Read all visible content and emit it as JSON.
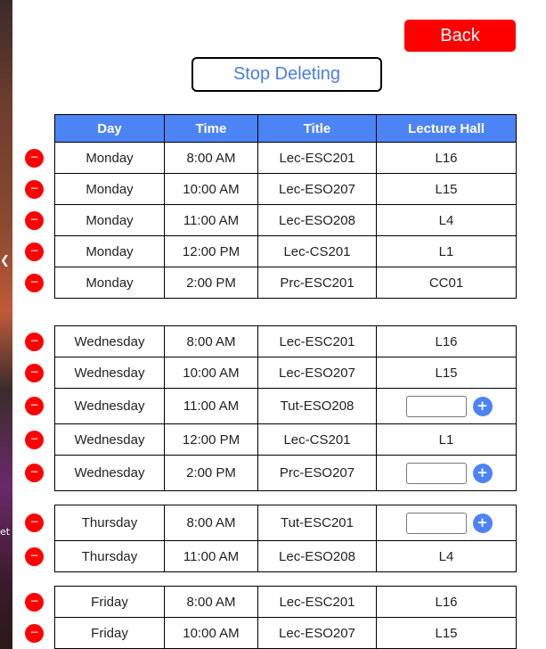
{
  "header": {
    "back_label": "Back",
    "stop_deleting_label": "Stop Deleting"
  },
  "columns": [
    "Day",
    "Time",
    "Title",
    "Lecture Hall"
  ],
  "icons": {
    "delete": "minus-circle-icon",
    "add": "plus-circle-icon"
  },
  "colors": {
    "back": "#ff0000",
    "header": "#4d84f5",
    "delete": "#ff0000",
    "add": "#4d84f5",
    "link": "#4a7de0"
  },
  "groups": [
    {
      "rows": [
        {
          "day": "Monday",
          "time": "8:00 AM",
          "title": "Lec-ESC201",
          "hall": "L16"
        },
        {
          "day": "Monday",
          "time": "10:00 AM",
          "title": "Lec-ESO207",
          "hall": "L15"
        },
        {
          "day": "Monday",
          "time": "11:00 AM",
          "title": "Lec-ESO208",
          "hall": "L4"
        },
        {
          "day": "Monday",
          "time": "12:00 PM",
          "title": "Lec-CS201",
          "hall": "L1"
        },
        {
          "day": "Monday",
          "time": "2:00 PM",
          "title": "Prc-ESC201",
          "hall": "CC01"
        }
      ]
    },
    {
      "rows": [
        {
          "day": "Wednesday",
          "time": "8:00 AM",
          "title": "Lec-ESC201",
          "hall": "L16"
        },
        {
          "day": "Wednesday",
          "time": "10:00 AM",
          "title": "Lec-ESO207",
          "hall": "L15"
        },
        {
          "day": "Wednesday",
          "time": "11:00 AM",
          "title": "Tut-ESO208",
          "hall": ""
        },
        {
          "day": "Wednesday",
          "time": "12:00 PM",
          "title": "Lec-CS201",
          "hall": "L1"
        },
        {
          "day": "Wednesday",
          "time": "2:00 PM",
          "title": "Prc-ESO207",
          "hall": ""
        }
      ]
    },
    {
      "rows": [
        {
          "day": "Thursday",
          "time": "8:00 AM",
          "title": "Tut-ESC201",
          "hall": ""
        },
        {
          "day": "Thursday",
          "time": "11:00 AM",
          "title": "Lec-ESO208",
          "hall": "L4"
        }
      ]
    },
    {
      "rows": [
        {
          "day": "Friday",
          "time": "8:00 AM",
          "title": "Lec-ESC201",
          "hall": "L16"
        },
        {
          "day": "Friday",
          "time": "10:00 AM",
          "title": "Lec-ESO207",
          "hall": "L15"
        }
      ]
    }
  ],
  "delete_symbol": "−",
  "add_symbol": "+"
}
